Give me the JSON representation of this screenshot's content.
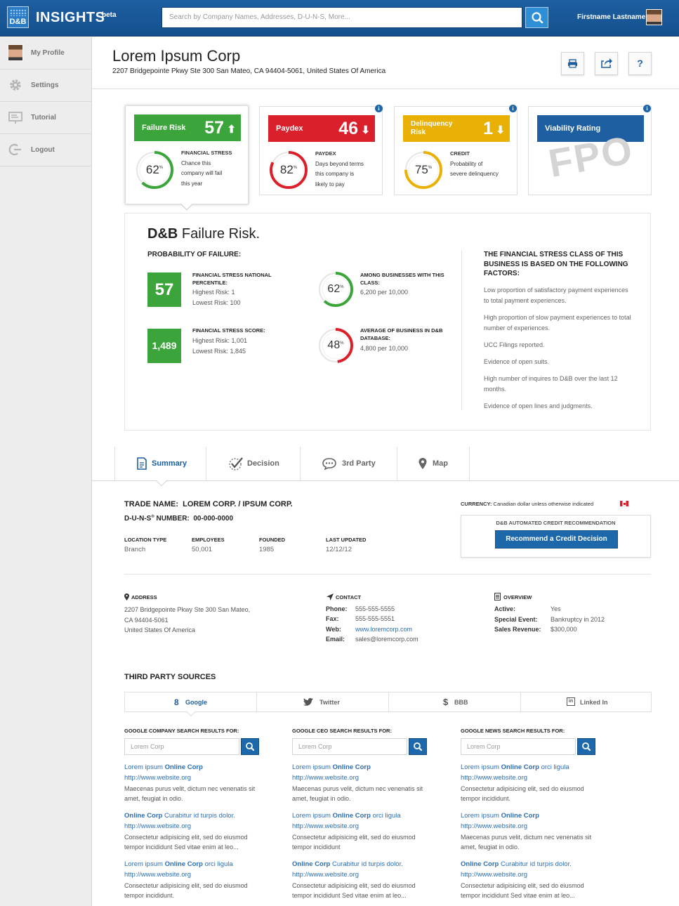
{
  "app": {
    "logo_text": "D&B",
    "title": "INSIGHTS",
    "beta": "beta"
  },
  "search": {
    "placeholder": "Search by Company Names, Addresses, D-U-N-S, More..."
  },
  "user": {
    "name": "Firstname Lastname"
  },
  "sidebar": {
    "items": [
      {
        "label": "My Profile",
        "icon": "avatar"
      },
      {
        "label": "Settings",
        "icon": "gear-icon"
      },
      {
        "label": "Tutorial",
        "icon": "presentation-icon"
      },
      {
        "label": "Logout",
        "icon": "logout-icon"
      }
    ]
  },
  "company": {
    "name": "Lorem Ipsum Corp",
    "address": "2207 Bridgepointe Pkwy Ste 300 San Mateo, CA 94404-5061, United States Of America"
  },
  "header_actions": [
    "print-icon",
    "share-icon",
    "help-icon"
  ],
  "header_help": "?",
  "cards": [
    {
      "title": "Failure Risk",
      "value": "57",
      "trend": "up",
      "arrow": "⬆",
      "color": "#3ba53b",
      "percent": 62,
      "percent_text": "62",
      "desc_title": "FINANCIAL STRESS",
      "desc": [
        "Chance this",
        "company will fail",
        "this year"
      ]
    },
    {
      "title": "Paydex",
      "value": "46",
      "trend": "down",
      "arrow": "⬇",
      "color": "#d9202b",
      "percent": 82,
      "percent_text": "82",
      "desc_title": "PAYDEX",
      "desc": [
        "Days beyond terms",
        "this company is",
        "likely to pay"
      ]
    },
    {
      "title": "Delinquency Risk",
      "value": "1",
      "trend": "down",
      "arrow": "⬇",
      "color": "#e9b106",
      "percent": 75,
      "percent_text": "75",
      "desc_title": "CREDIT",
      "desc": [
        "Probability of",
        "severe delinquency"
      ]
    },
    {
      "title": "Viability Rating",
      "color": "#1d5fa1",
      "watermark": "FPO"
    }
  ],
  "info_label": "i",
  "percent_sign": "%",
  "failure_panel": {
    "title_bold": "D&B",
    "title_rest": " Failure Risk.",
    "subtitle": "PROBABILITY OF FAILURE:",
    "percentile": {
      "value": "57",
      "label": "FINANCIAL STRESS NATIONAL PERCENTILE:",
      "lines": [
        "Highest Risk: 1",
        "Lowest Risk: 100"
      ]
    },
    "score": {
      "value": "1,489",
      "label": "FINANCIAL STRESS SCORE:",
      "lines": [
        "Highest Risk: 1,001",
        "Lowest Risk: 1,845"
      ]
    },
    "among": {
      "percent": 62,
      "percent_text": "62",
      "label": "AMONG BUSINESSES WITH THIS CLASS:",
      "line": "6,200 per 10,000"
    },
    "average": {
      "percent": 48,
      "percent_text": "48",
      "label": "AVERAGE OF BUSINESS IN D&B DATABASE:",
      "line": "4,800 per 10,000"
    },
    "factors_title": "THE FINANCIAL STRESS CLASS OF THIS BUSINESS IS BASED ON THE FOLLOWING FACTORS:",
    "factors": [
      "Low proportion of satisfactory payment experiences to total payment experiences.",
      "High proportion of slow payment experiences to total number of experiences.",
      "UCC Filings reported.",
      "Evidence of open suits.",
      "High number of inquires to D&B over the last 12 months.",
      "Evidence of open lines and judgments."
    ]
  },
  "tabs": [
    {
      "label": "Summary",
      "icon": "document-icon",
      "active": true
    },
    {
      "label": "Decision",
      "icon": "checkmark-icon"
    },
    {
      "label": "3rd Party",
      "icon": "chat-bubble-icon"
    },
    {
      "label": "Map",
      "icon": "map-pin-icon"
    }
  ],
  "summary": {
    "trade_name_label": "TRADE NAME:",
    "trade_name": "LOREM CORP. / IPSUM CORP.",
    "duns_label": "D-U-N-S",
    "duns_sup": "®",
    "duns_label2": " NUMBER:",
    "duns": "00-000-0000",
    "fields": [
      {
        "label": "LOCATION TYPE",
        "value": "Branch"
      },
      {
        "label": "EMPLOYEES",
        "value": "50,001"
      },
      {
        "label": "FOUNDED",
        "value": "1985"
      },
      {
        "label": "LAST UPDATED",
        "value": "12/12/12"
      }
    ],
    "currency_label": "CURRENCY:",
    "currency": "Canadian dollar unless otherwise indicated",
    "recommendation_title": "D&B AUTOMATED CREDIT RECOMMENDATION",
    "recommendation_button": "Recommend a Credit Decision",
    "address_title": "ADDRESS",
    "address_lines": [
      "2207 Bridgepointe Pkwy Ste 300 San Mateo,",
      "CA 94404-5061",
      "United States Of America"
    ],
    "contact_title": "CONTACT",
    "contact": [
      {
        "k": "Phone:",
        "v": "555-555-5555"
      },
      {
        "k": "Fax:",
        "v": "555-555-5551"
      },
      {
        "k": "Web:",
        "v": "www.loremcorp.com"
      },
      {
        "k": "Email:",
        "v": "sales@loremcorp.com"
      }
    ],
    "overview_title": "OVERVIEW",
    "overview": [
      {
        "k": "Active:",
        "v": "Yes"
      },
      {
        "k": "Special Event:",
        "v": "Bankruptcy in 2012"
      },
      {
        "k": "Sales Revenue:",
        "v": "$300,000"
      }
    ]
  },
  "third_party": {
    "title": "THIRD PARTY SOURCES",
    "tabs": [
      {
        "label": "Google",
        "icon": "google-icon",
        "glyph": "8",
        "active": true
      },
      {
        "label": "Twitter",
        "icon": "twitter-icon",
        "glyph": "🐦"
      },
      {
        "label": "BBB",
        "icon": "bbb-icon",
        "glyph": "$"
      },
      {
        "label": "Linked In",
        "icon": "linkedin-icon",
        "glyph": "in"
      }
    ],
    "columns": [
      {
        "header": "GOOGLE COMPANY SEARCH RESULTS FOR:",
        "placeholder": "Lorem Corp",
        "results": [
          {
            "pre": "Lorem ipsum ",
            "bold": "Online Corp",
            "post": "",
            "url": "http://www.website.org",
            "desc": "Maecenas purus velit, dictum nec venenatis sit amet, feugiat in odio."
          },
          {
            "pre": "",
            "bold": "Online Corp",
            "post": " Curabitur id turpis dolor.",
            "url": "http://www.website.org",
            "desc": "Consectetur adipisicing elit, sed do eiusmod tempor incididunt Sed vitae enim at leo..."
          },
          {
            "pre": "Lorem ipsum ",
            "bold": "Online Corp",
            "post": " orci ligula",
            "url": "http://www.website.org",
            "desc": "Consectetur adipisicing elit, sed do eiusmod tempor incididunt."
          }
        ]
      },
      {
        "header": "GOOGLE CEO SEARCH RESULTS FOR:",
        "placeholder": "Lorem Corp",
        "results": [
          {
            "pre": "Lorem ipsum ",
            "bold": "Online Corp",
            "post": "",
            "url": "http://www.website.org",
            "desc": "Maecenas purus velit, dictum nec venenatis sit amet, feugiat in odio."
          },
          {
            "pre": "Lorem ipsum ",
            "bold": "Online Corp",
            "post": " orci ligula",
            "url": "http://www.website.org",
            "desc": "Consectetur adipisicing elit, sed do eiusmod tempor incididunt"
          },
          {
            "pre": "",
            "bold": "Online Corp",
            "post": " Curabitur id turpis dolor.",
            "url": "http://www.website.org",
            "desc": "Consectetur adipisicing elit, sed do eiusmod tempor incididunt Sed vitae enim at leo..."
          }
        ]
      },
      {
        "header": "GOOGLE NEWS SEARCH RESULTS FOR:",
        "placeholder": "Lorem Corp",
        "results": [
          {
            "pre": "Lorem ipsum ",
            "bold": "Online Corp",
            "post": " orci ligula",
            "url": "http://www.website.org",
            "desc": "Consectetur adipisicing elit, sed do eiusmod tempor incididunt."
          },
          {
            "pre": "Lorem ipsum ",
            "bold": "Online Corp",
            "post": "",
            "url": "http://www.website.org",
            "desc": "Maecenas purus velit, dictum nec venenatis sit amet, feugiat in odio."
          },
          {
            "pre": "",
            "bold": "Online Corp",
            "post": " Curabitur id turpis dolor.",
            "url": "http://www.website.org",
            "desc": "Consectetur adipisicing elit, sed do eiusmod tempor incididunt Sed vitae enim at leo..."
          }
        ]
      }
    ]
  }
}
